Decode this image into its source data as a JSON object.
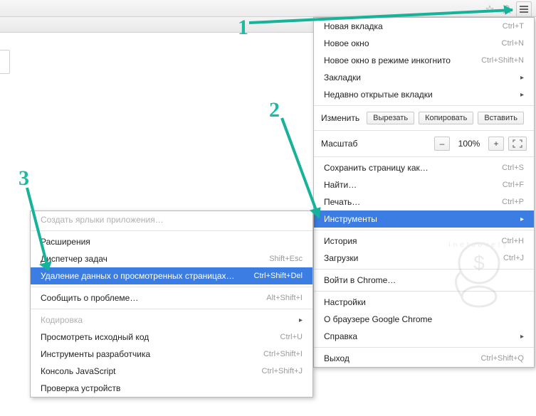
{
  "browser": {
    "star_icon": "☆",
    "user_icon": "◯"
  },
  "mainMenu": {
    "newTab": {
      "label": "Новая вкладка",
      "shortcut": "Ctrl+T"
    },
    "newWindow": {
      "label": "Новое окно",
      "shortcut": "Ctrl+N"
    },
    "incognito": {
      "label": "Новое окно в режиме инкогнито",
      "shortcut": "Ctrl+Shift+N"
    },
    "bookmarks": {
      "label": "Закладки"
    },
    "recentTabs": {
      "label": "Недавно открытые вкладки"
    },
    "edit": {
      "label": "Изменить",
      "cut": "Вырезать",
      "copy": "Копировать",
      "paste": "Вставить"
    },
    "zoom": {
      "label": "Масштаб",
      "minus": "–",
      "value": "100%",
      "plus": "+"
    },
    "savePage": {
      "label": "Сохранить страницу как…",
      "shortcut": "Ctrl+S"
    },
    "find": {
      "label": "Найти…",
      "shortcut": "Ctrl+F"
    },
    "print": {
      "label": "Печать…",
      "shortcut": "Ctrl+P"
    },
    "tools": {
      "label": "Инструменты"
    },
    "history": {
      "label": "История",
      "shortcut": "Ctrl+H"
    },
    "downloads": {
      "label": "Загрузки",
      "shortcut": "Ctrl+J"
    },
    "signin": {
      "label": "Войти в Chrome…"
    },
    "settings": {
      "label": "Настройки"
    },
    "about": {
      "label": "О браузере Google Chrome"
    },
    "help": {
      "label": "Справка"
    },
    "exit": {
      "label": "Выход",
      "shortcut": "Ctrl+Shift+Q"
    }
  },
  "subMenu": {
    "createShortcuts": {
      "label": "Создать ярлыки приложения…"
    },
    "extensions": {
      "label": "Расширения"
    },
    "taskManager": {
      "label": "Диспетчер задач",
      "shortcut": "Shift+Esc"
    },
    "clearData": {
      "label": "Удаление данных о просмотренных страницах…",
      "shortcut": "Ctrl+Shift+Del"
    },
    "report": {
      "label": "Сообщить о проблеме…",
      "shortcut": "Alt+Shift+I"
    },
    "encoding": {
      "label": "Кодировка"
    },
    "viewSource": {
      "label": "Просмотреть исходный код",
      "shortcut": "Ctrl+U"
    },
    "devTools": {
      "label": "Инструменты разработчика",
      "shortcut": "Ctrl+Shift+I"
    },
    "jsConsole": {
      "label": "Консоль JavaScript",
      "shortcut": "Ctrl+Shift+J"
    },
    "checkDevices": {
      "label": "Проверка устройств"
    }
  },
  "annotations": {
    "n1": "1",
    "n2": "2",
    "n3": "3"
  },
  "watermark": {
    "text": "inetsovety.ru"
  }
}
